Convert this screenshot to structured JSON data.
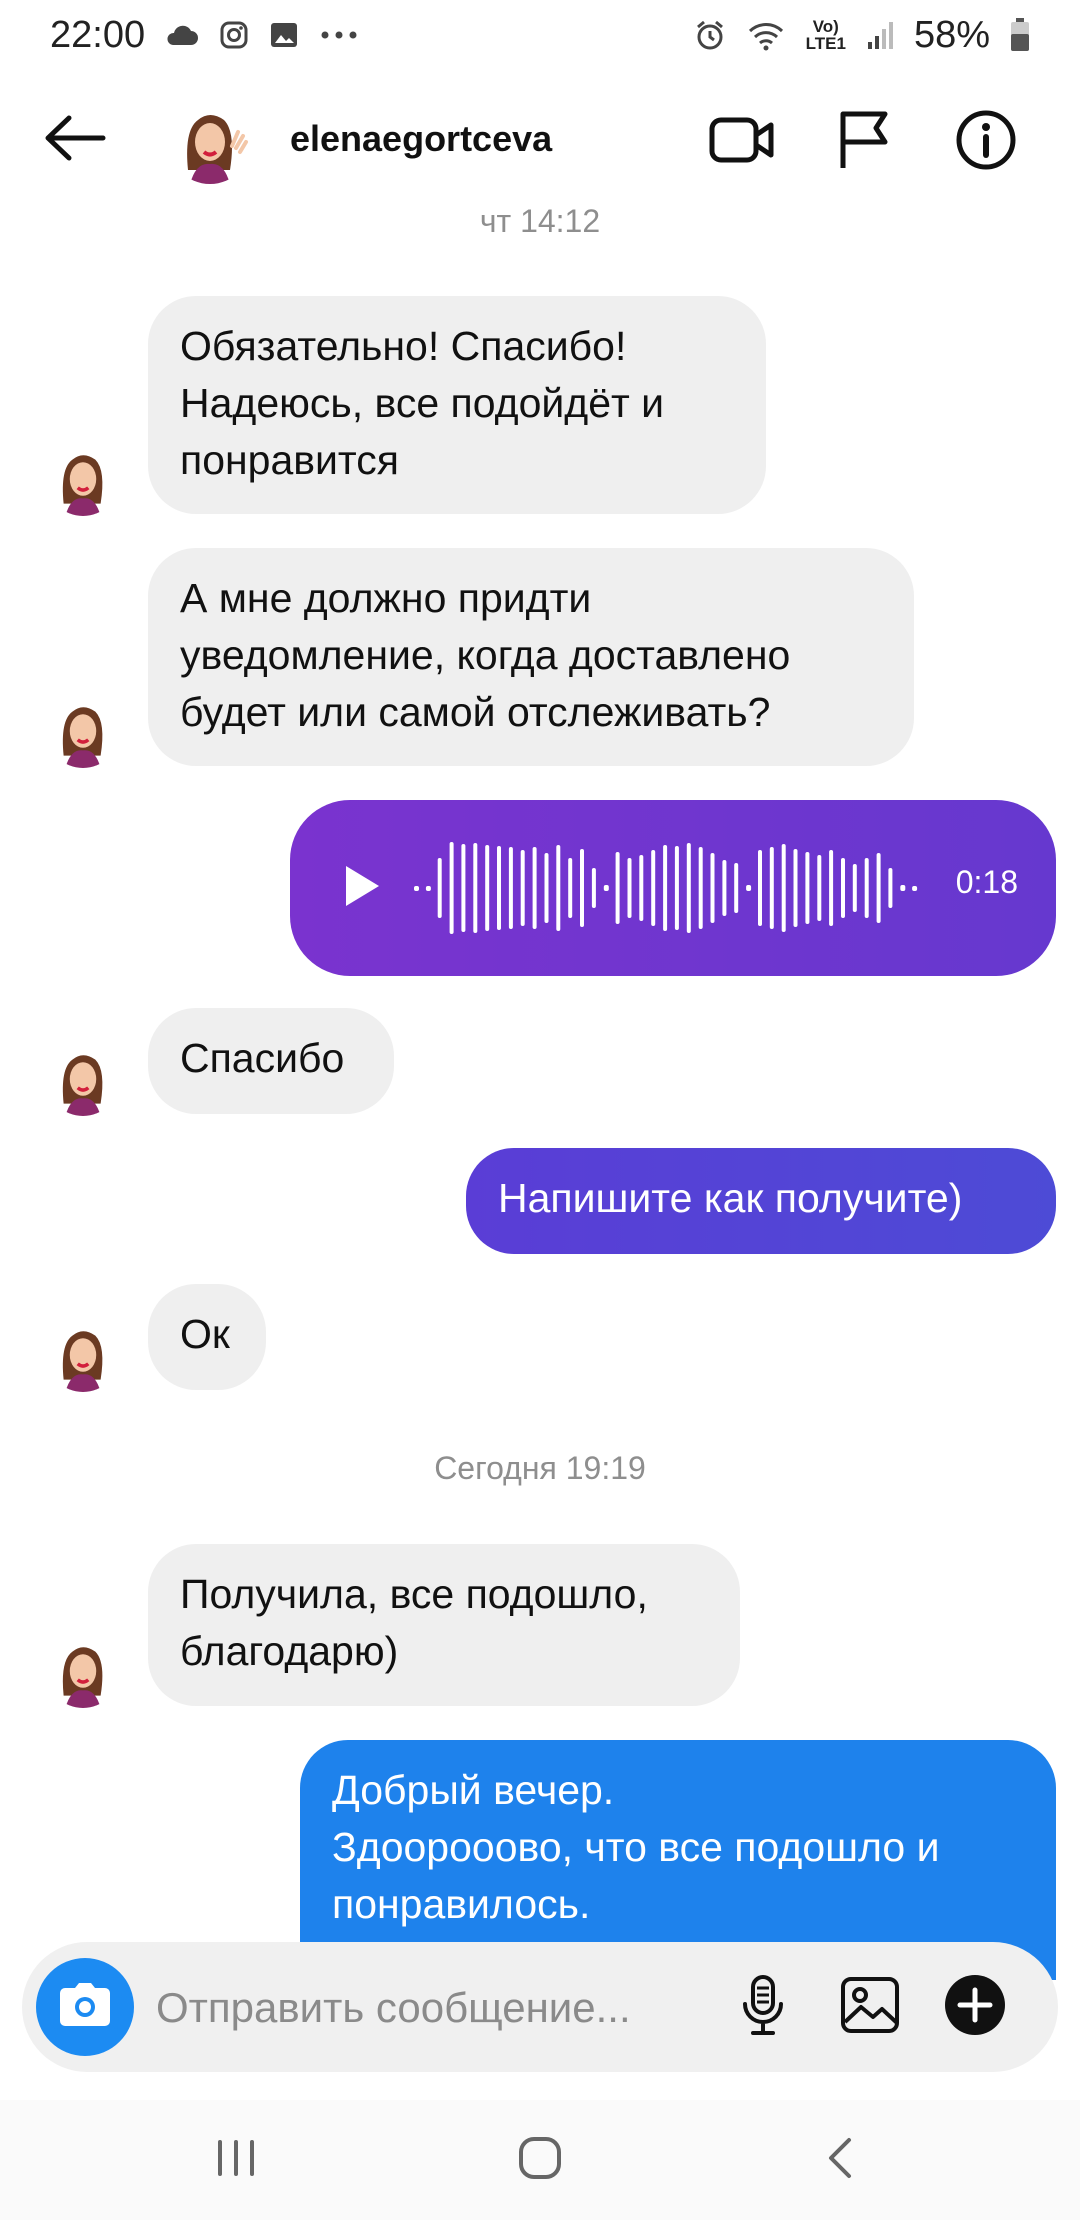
{
  "status_bar": {
    "time": "22:00",
    "battery": "58%",
    "network_label": "LTE1",
    "left_icons": [
      "cloud-icon",
      "instagram-icon",
      "gallery-icon",
      "more-dots-icon"
    ],
    "right_icons": [
      "alarm-icon",
      "wifi-icon",
      "volte-icon",
      "signal-icon",
      "battery-icon"
    ]
  },
  "header": {
    "username": "elenaegortceva",
    "icons": [
      "back-arrow-icon",
      "video-call-icon",
      "flag-icon",
      "info-icon"
    ]
  },
  "conversation": {
    "timestamp_1": "чт 14:12",
    "timestamp_2": "Сегодня 19:19",
    "messages": [
      {
        "from": "them",
        "text": "Обязательно! Спасибо!\nНадеюсь, все подойдёт и\nпонравится"
      },
      {
        "from": "them",
        "text": "А мне должно придти\nуведомление, когда доставлено\nбудет или самой отслеживать?"
      },
      {
        "from": "me",
        "type": "voice",
        "duration": "0:18"
      },
      {
        "from": "them",
        "text": "Спасибо"
      },
      {
        "from": "me",
        "text": "Напишите как получите)"
      },
      {
        "from": "them",
        "text": "Ок"
      },
      {
        "from": "them",
        "text": "Получила, все подошло,\nблагодарю)"
      },
      {
        "from": "me",
        "text": "Добрый вечер.\nЗдоорооово, что все подошло и\nпонравилось."
      }
    ]
  },
  "composer": {
    "placeholder": "Отправить сообщение...",
    "icons": [
      "camera-icon",
      "microphone-icon",
      "image-icon",
      "add-icon"
    ]
  },
  "nav_bar": {
    "icons": [
      "recent-apps-icon",
      "home-icon",
      "nav-back-icon"
    ]
  },
  "colors": {
    "incoming_bubble": "#efefef",
    "voice_bubble": "#7034cf",
    "sent_bubble_1": "#5244d6",
    "sent_bubble_2": "#1e82ec",
    "camera_button": "#1c8bf2"
  }
}
